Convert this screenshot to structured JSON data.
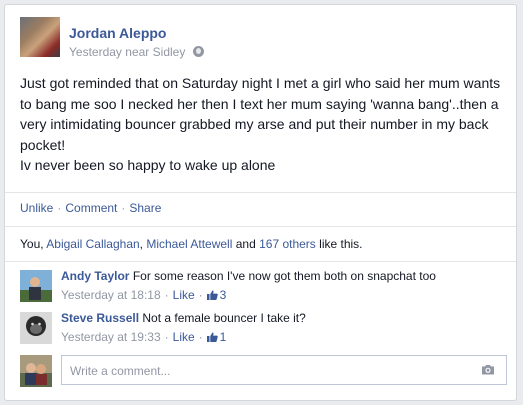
{
  "post": {
    "author": "Jordan Aleppo",
    "time": "Yesterday",
    "location_prefix": "near",
    "location": "Sidley",
    "privacy_icon": "globe-icon",
    "text_lines": [
      "Just got reminded that on Saturday night I met a girl who said her mum wants to bang me soo I necked her then I text her mum saying 'wanna bang'..then a very intimidating bouncer grabbed my arse and put their number in my back pocket!",
      "Iv never been so happy to wake up alone"
    ]
  },
  "actions": {
    "unlike": "Unlike",
    "comment": "Comment",
    "share": "Share",
    "separator": "·"
  },
  "likes": {
    "prefix": "You, ",
    "person1": "Abigail Callaghan",
    "comma": ", ",
    "person2": "Michael Attewell",
    "and": " and ",
    "others": "167 others",
    "suffix": " like this."
  },
  "comments": [
    {
      "name": "Andy Taylor",
      "text": "For some reason I've now got them both on snapchat too",
      "time": "Yesterday at 18:18",
      "like_label": "Like",
      "like_count": "3"
    },
    {
      "name": "Steve Russell",
      "text": "Not a female bouncer I take it?",
      "time": "Yesterday at 19:33",
      "like_label": "Like",
      "like_count": "1"
    }
  ],
  "composer": {
    "placeholder": "Write a comment...",
    "camera_icon": "camera-icon"
  },
  "colors": {
    "link": "#3b5998",
    "muted": "#9197a3",
    "background": "#e9ebee"
  }
}
